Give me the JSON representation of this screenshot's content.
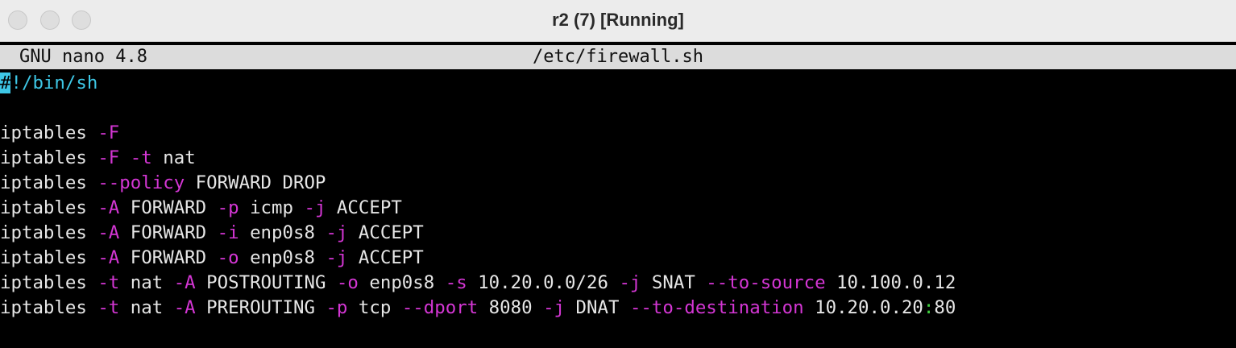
{
  "window": {
    "title": "r2 (7) [Running]"
  },
  "nano": {
    "version": "GNU nano 4.8",
    "filename": "/etc/firewall.sh"
  },
  "editor": {
    "shebang_cursor": "#",
    "shebang_rest": "!/bin/sh",
    "lines": [
      [
        {
          "text": "iptables ",
          "c": "white"
        },
        {
          "text": "-F",
          "c": "magenta"
        }
      ],
      [
        {
          "text": "iptables ",
          "c": "white"
        },
        {
          "text": "-F",
          "c": "magenta"
        },
        {
          "text": " ",
          "c": "white"
        },
        {
          "text": "-t",
          "c": "magenta"
        },
        {
          "text": " nat",
          "c": "white"
        }
      ],
      [
        {
          "text": "iptables ",
          "c": "white"
        },
        {
          "text": "--policy",
          "c": "magenta"
        },
        {
          "text": " FORWARD DROP",
          "c": "white"
        }
      ],
      [
        {
          "text": "iptables ",
          "c": "white"
        },
        {
          "text": "-A",
          "c": "magenta"
        },
        {
          "text": " FORWARD ",
          "c": "white"
        },
        {
          "text": "-p",
          "c": "magenta"
        },
        {
          "text": " icmp ",
          "c": "white"
        },
        {
          "text": "-j",
          "c": "magenta"
        },
        {
          "text": " ACCEPT",
          "c": "white"
        }
      ],
      [
        {
          "text": "iptables ",
          "c": "white"
        },
        {
          "text": "-A",
          "c": "magenta"
        },
        {
          "text": " FORWARD ",
          "c": "white"
        },
        {
          "text": "-i",
          "c": "magenta"
        },
        {
          "text": " enp0s8 ",
          "c": "white"
        },
        {
          "text": "-j",
          "c": "magenta"
        },
        {
          "text": " ACCEPT",
          "c": "white"
        }
      ],
      [
        {
          "text": "iptables ",
          "c": "white"
        },
        {
          "text": "-A",
          "c": "magenta"
        },
        {
          "text": " FORWARD ",
          "c": "white"
        },
        {
          "text": "-o",
          "c": "magenta"
        },
        {
          "text": " enp0s8 ",
          "c": "white"
        },
        {
          "text": "-j",
          "c": "magenta"
        },
        {
          "text": " ACCEPT",
          "c": "white"
        }
      ],
      [
        {
          "text": "iptables ",
          "c": "white"
        },
        {
          "text": "-t",
          "c": "magenta"
        },
        {
          "text": " nat ",
          "c": "white"
        },
        {
          "text": "-A",
          "c": "magenta"
        },
        {
          "text": " POSTROUTING ",
          "c": "white"
        },
        {
          "text": "-o",
          "c": "magenta"
        },
        {
          "text": " enp0s8 ",
          "c": "white"
        },
        {
          "text": "-s",
          "c": "magenta"
        },
        {
          "text": " 10.20.0.0/26 ",
          "c": "white"
        },
        {
          "text": "-j",
          "c": "magenta"
        },
        {
          "text": " SNAT ",
          "c": "white"
        },
        {
          "text": "--to-source",
          "c": "magenta"
        },
        {
          "text": " 10.100.0.12",
          "c": "white"
        }
      ],
      [
        {
          "text": "iptables ",
          "c": "white"
        },
        {
          "text": "-t",
          "c": "magenta"
        },
        {
          "text": " nat ",
          "c": "white"
        },
        {
          "text": "-A",
          "c": "magenta"
        },
        {
          "text": " PREROUTING ",
          "c": "white"
        },
        {
          "text": "-p",
          "c": "magenta"
        },
        {
          "text": " tcp ",
          "c": "white"
        },
        {
          "text": "--dport",
          "c": "magenta"
        },
        {
          "text": " 8080 ",
          "c": "white"
        },
        {
          "text": "-j",
          "c": "magenta"
        },
        {
          "text": " DNAT ",
          "c": "white"
        },
        {
          "text": "--to-destination",
          "c": "magenta"
        },
        {
          "text": " 10.20.0.20",
          "c": "white"
        },
        {
          "text": ":",
          "c": "green"
        },
        {
          "text": "80",
          "c": "white"
        }
      ]
    ]
  }
}
